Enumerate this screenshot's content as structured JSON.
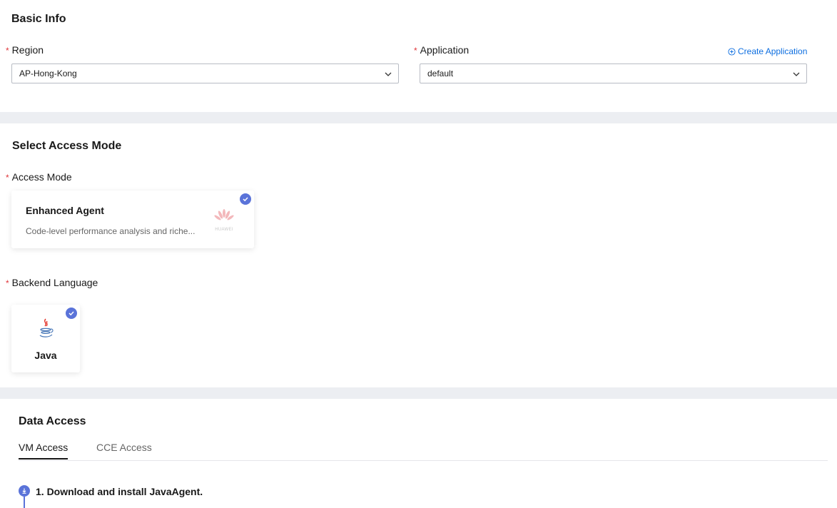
{
  "basic_info": {
    "title": "Basic Info",
    "region": {
      "label": "Region",
      "value": "AP-Hong-Kong",
      "required": "*"
    },
    "application": {
      "label": "Application",
      "value": "default",
      "required": "*"
    },
    "create_application": "Create Application"
  },
  "access_mode_section": {
    "title": "Select Access Mode",
    "access_mode": {
      "label": "Access Mode",
      "required": "*",
      "card": {
        "title": "Enhanced Agent",
        "description": "Code-level performance analysis and riche...",
        "logo_text": "HUAWEI",
        "selected": true
      }
    },
    "backend_language": {
      "label": "Backend Language",
      "required": "*",
      "card": {
        "title": "Java",
        "selected": true
      }
    }
  },
  "data_access": {
    "title": "Data Access",
    "tabs": [
      {
        "label": "VM Access",
        "active": true
      },
      {
        "label": "CCE Access",
        "active": false
      }
    ],
    "steps": [
      {
        "text": "1. Download and install JavaAgent."
      }
    ]
  },
  "colors": {
    "accent": "#5a73d9",
    "link": "#0d6ee0",
    "required": "#e0353a",
    "background": "#eceef2"
  }
}
